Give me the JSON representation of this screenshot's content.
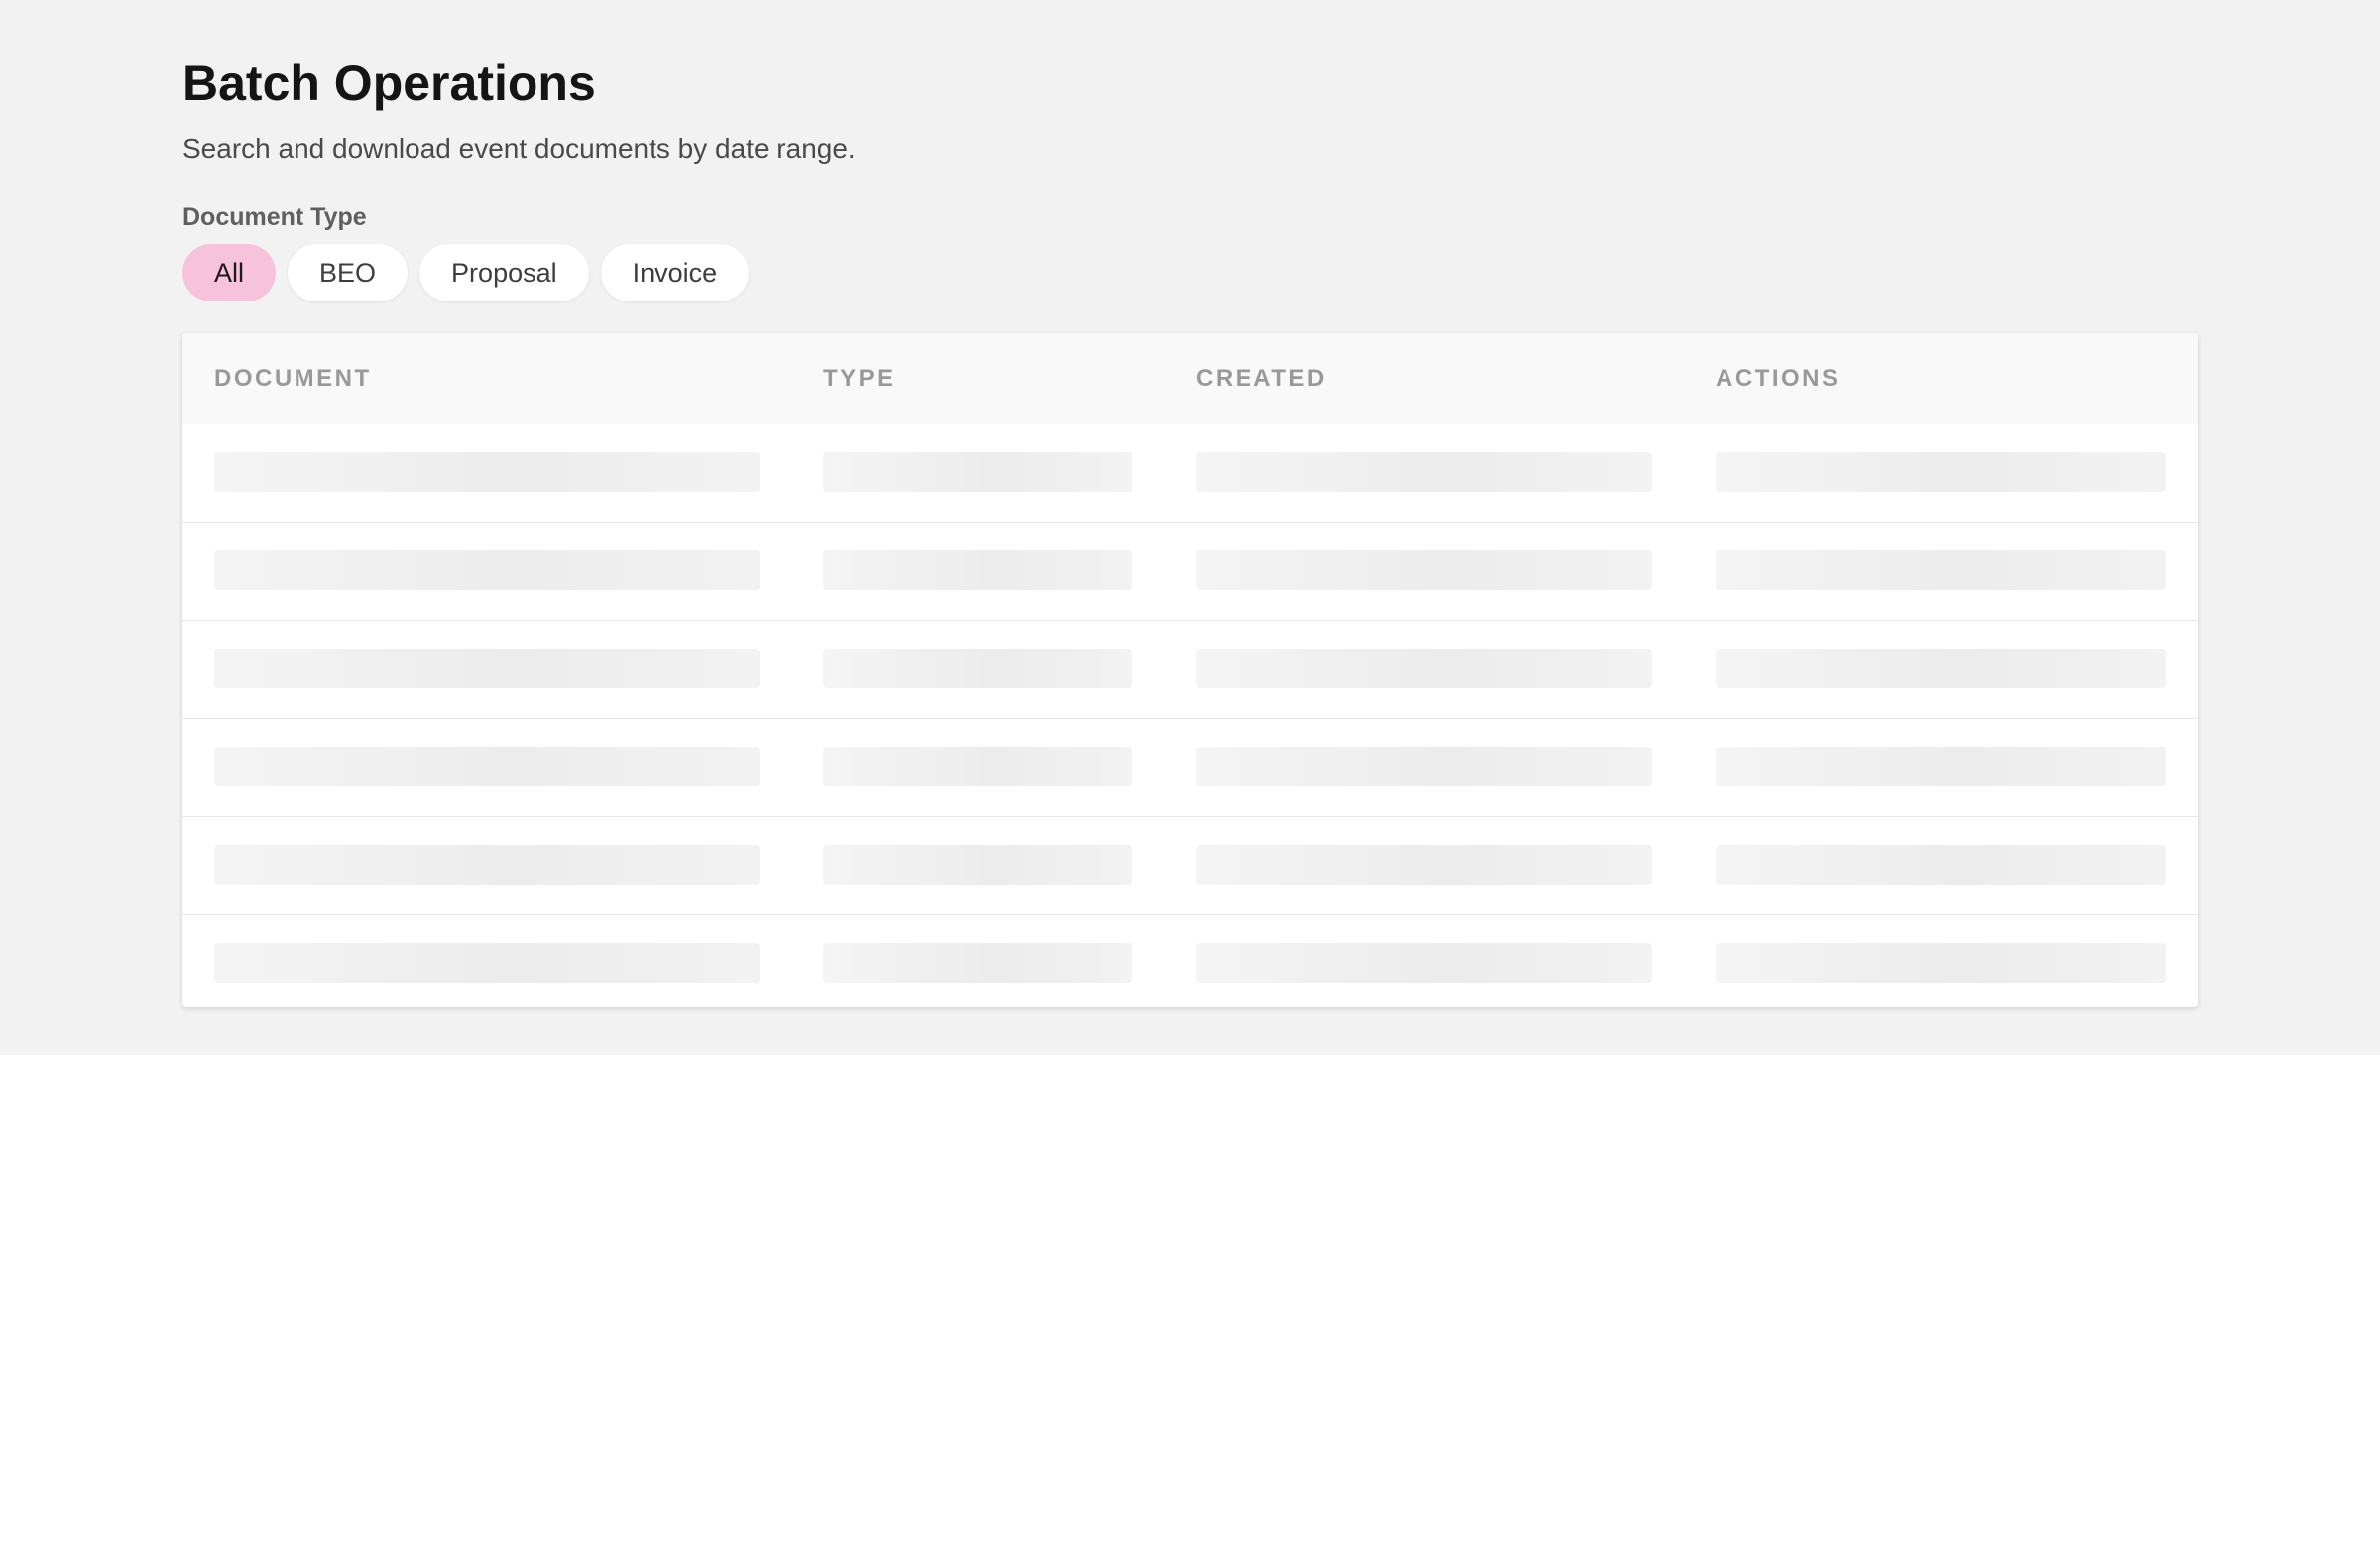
{
  "page": {
    "title": "Batch Operations",
    "subtitle": "Search and download event documents by date range."
  },
  "filter": {
    "label": "Document Type",
    "options": [
      "All",
      "BEO",
      "Proposal",
      "Invoice"
    ],
    "selected": "All"
  },
  "table": {
    "columns": [
      "DOCUMENT",
      "TYPE",
      "CREATED",
      "ACTIONS"
    ],
    "state": "loading",
    "skeleton_row_count": 6
  },
  "colors": {
    "accent_pill": "#f7c3dc",
    "page_background": "#f2f2f2",
    "header_text": "#999999"
  }
}
